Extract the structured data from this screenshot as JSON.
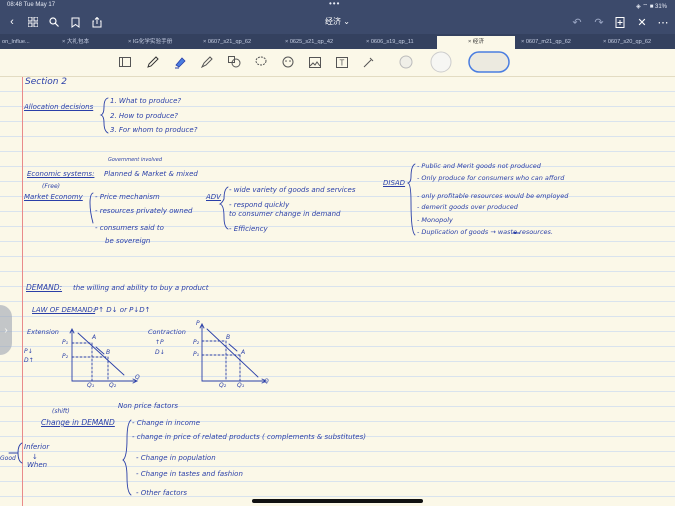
{
  "status": {
    "time": "08:48  Tue May 17",
    "dots": "•••",
    "right": "◈ ⌔ ■ 31%"
  },
  "nav": {
    "title": "经济 ⌄"
  },
  "tabs": [
    {
      "label": "on_Influe..."
    },
    {
      "label": "× 大礼包本"
    },
    {
      "label": "× IG化学实验手册"
    },
    {
      "label": "× 0607_s21_qp_62"
    },
    {
      "label": "× 0625_s21_qp_42"
    },
    {
      "label": "× 0606_s19_qp_11"
    },
    {
      "label": "×              经济"
    },
    {
      "label": "× 0607_m21_qp_62"
    },
    {
      "label": "× 0607_s20_qp_62"
    }
  ],
  "colors": {
    "bar": "#3c4a6b",
    "ink": "#2a3fa8",
    "paper": "#fbf8e8",
    "accent": "#4a7de0"
  },
  "notes": {
    "section": "Section 2",
    "alloc_label": "Allocation decisions",
    "alloc_1": "1. What to produce?",
    "alloc_2": "2. How to produce?",
    "alloc_3": "3. For whom to produce?",
    "econ_sup": "Government involved",
    "econ_label": "Economic systems:",
    "econ_val": "Planned & Market & mixed",
    "free": "(Free)",
    "market_label": "Market Economy",
    "m1": "- Price mechanism",
    "m2": "- resources privately owned",
    "m3": "- consumers said to",
    "m3b": "be sovereign",
    "adv": "ADV",
    "a1": "- wide variety of goods and services",
    "a2": "- respond quickly",
    "a2b": "to consumer change in demand",
    "a3": "- Efficiency",
    "disad": "DISAD",
    "d1": "- Public and Merit goods not produced",
    "d2": "- Only produce for consumers who can afford",
    "d3": "- only profitable resources would be employed",
    "d4": "- demerit goods over produced",
    "d5": "- Monopoly",
    "d6": "- Duplication of goods → waste resources.",
    "demand_label": "DEMAND:",
    "demand_def": "the willing and ability to buy a product",
    "law_label": "LAW OF DEMAND:",
    "law_val": "P↑ D↓  or P↓D↑",
    "ext": "Extension",
    "contr": "Contraction",
    "pdown": "P↓",
    "dup": "D↑",
    "pup": "↑P",
    "ddown": "D↓",
    "p1": "P₁",
    "p2": "P₂",
    "q1": "Q₁",
    "q2": "Q₂",
    "pa": "A",
    "pb": "B",
    "axp": "P",
    "axq": "Q",
    "nonprice": "Non price factors",
    "shift": "(shift)",
    "change_label": "Change in DEMAND",
    "c1": "- Change in income",
    "c2": "- change in price of related products ( complements & substitutes)",
    "c3": "- Change in population",
    "c4": "- Change in tastes and fashion",
    "c5": "- Other factors",
    "inferior": "Inferior",
    "goods": "Good",
    "arrow_down": "↓",
    "when": "When"
  }
}
